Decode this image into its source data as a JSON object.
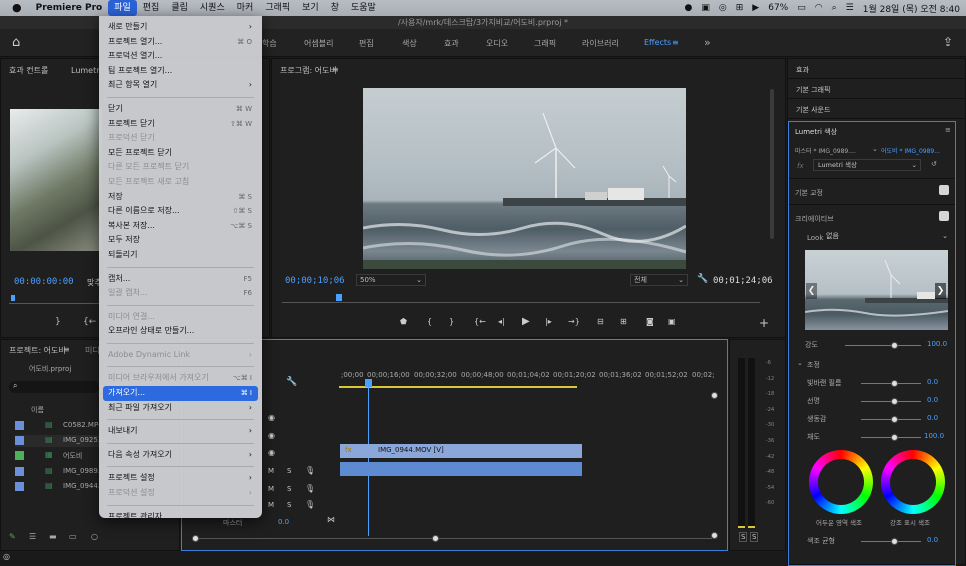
{
  "menubar": {
    "app": "Premiere Pro",
    "items": [
      "파일",
      "편집",
      "클립",
      "시퀀스",
      "마커",
      "그래픽",
      "보기",
      "창",
      "도움말"
    ],
    "battery": "67%",
    "datetime": "1월 28일 (목) 오전 8:40"
  },
  "title": "/사용자/mrk/데스크탑/3가지비교/어도비.prproj *",
  "workspaces": [
    "학습",
    "어셈블리",
    "편집",
    "색상",
    "효과",
    "오디오",
    "그래픽",
    "라이브러리",
    "Effects"
  ],
  "file_menu": {
    "groups": [
      [
        {
          "label": "새로 만들기",
          "shortcut": "",
          "arrow": true,
          "disabled": false
        },
        {
          "label": "프로젝트 열기...",
          "shortcut": "⌘ O",
          "arrow": false,
          "disabled": false
        },
        {
          "label": "프로덕션 열기...",
          "shortcut": "",
          "arrow": false,
          "disabled": false
        },
        {
          "label": "팀 프로젝트 열기...",
          "shortcut": "",
          "arrow": false,
          "disabled": false
        },
        {
          "label": "최근 항목 열기",
          "shortcut": "",
          "arrow": true,
          "disabled": false
        }
      ],
      [
        {
          "label": "닫기",
          "shortcut": "⌘ W",
          "arrow": false,
          "disabled": false
        },
        {
          "label": "프로젝트 닫기",
          "shortcut": "⇧⌘ W",
          "arrow": false,
          "disabled": false
        },
        {
          "label": "프로덕션 닫기",
          "shortcut": "",
          "arrow": false,
          "disabled": true
        },
        {
          "label": "모든 프로젝트 닫기",
          "shortcut": "",
          "arrow": false,
          "disabled": false
        },
        {
          "label": "다른 모든 프로젝트 닫기",
          "shortcut": "",
          "arrow": false,
          "disabled": true
        },
        {
          "label": "모든 프로젝트 새로 고침",
          "shortcut": "",
          "arrow": false,
          "disabled": true
        },
        {
          "label": "저장",
          "shortcut": "⌘ S",
          "arrow": false,
          "disabled": false
        },
        {
          "label": "다른 이름으로 저장...",
          "shortcut": "⇧⌘ S",
          "arrow": false,
          "disabled": false
        },
        {
          "label": "복사본 저장...",
          "shortcut": "⌥⌘ S",
          "arrow": false,
          "disabled": false
        },
        {
          "label": "모두 저장",
          "shortcut": "",
          "arrow": false,
          "disabled": false
        },
        {
          "label": "되돌리기",
          "shortcut": "",
          "arrow": false,
          "disabled": false
        }
      ],
      [
        {
          "label": "캡처...",
          "shortcut": "F5",
          "arrow": false,
          "disabled": false
        },
        {
          "label": "일괄 캡처...",
          "shortcut": "F6",
          "arrow": false,
          "disabled": true
        }
      ],
      [
        {
          "label": "미디어 연결...",
          "shortcut": "",
          "arrow": false,
          "disabled": true
        },
        {
          "label": "오프라인 상태로 만들기...",
          "shortcut": "",
          "arrow": false,
          "disabled": false
        }
      ],
      [
        {
          "label": "Adobe Dynamic Link",
          "shortcut": "",
          "arrow": true,
          "disabled": true
        }
      ],
      [
        {
          "label": "미디어 브라우저에서 가져오기",
          "shortcut": "⌥⌘ I",
          "arrow": false,
          "disabled": true
        },
        {
          "label": "가져오기...",
          "shortcut": "⌘ I",
          "arrow": false,
          "disabled": false,
          "highlight": true
        },
        {
          "label": "최근 파일 가져오기",
          "shortcut": "",
          "arrow": true,
          "disabled": false
        }
      ],
      [
        {
          "label": "내보내기",
          "shortcut": "",
          "arrow": true,
          "disabled": false
        }
      ],
      [
        {
          "label": "다음 속성 가져오기",
          "shortcut": "",
          "arrow": true,
          "disabled": false
        }
      ],
      [
        {
          "label": "프로젝트 설정",
          "shortcut": "",
          "arrow": true,
          "disabled": false
        },
        {
          "label": "프로덕션 설정",
          "shortcut": "",
          "arrow": true,
          "disabled": true
        }
      ],
      [
        {
          "label": "프로젝트 관리자...",
          "shortcut": "",
          "arrow": false,
          "disabled": false
        }
      ]
    ]
  },
  "source_panel": {
    "tabs": [
      "효과 컨트롤",
      "Lumetri 범"
    ],
    "timecode": "00:00:00:00",
    "fit": "맞추"
  },
  "program": {
    "title": "프로그램: 어도비",
    "timecode": "00;00;10;06",
    "zoom": "50%",
    "quality": "전체",
    "duration": "00;01;24;06"
  },
  "project": {
    "title": "프로젝트: 어도비",
    "tab2": "미디",
    "file": "어도비.prproj",
    "col_name": "이름",
    "items": [
      "C0582.MP4",
      "IMG_0925.M",
      "어도비",
      "IMG_0989.",
      "IMG_0944."
    ]
  },
  "timeline": {
    "ruler": [
      ";00;00",
      "00;00;16;00",
      "00;00;32;00",
      "00;00;48;00",
      "00;01;04;02",
      "00;01;20;02",
      "00;01;36;02",
      "00;01;52;02",
      "00;02;"
    ],
    "clip": "IMG_0944.MOV [V]",
    "master": "마스터",
    "master_val": "0.0",
    "track_letters": [
      "M",
      "S"
    ]
  },
  "meter_scale": [
    "-6",
    "-12",
    "-18",
    "-24",
    "-30",
    "-36",
    "-42",
    "-48",
    "-54",
    "-60"
  ],
  "meter_buttons": [
    "S",
    "S"
  ],
  "effects_panel": {
    "items": [
      "효과",
      "기본 그래픽",
      "기본 사운드"
    ],
    "lumetri_title": "Lumetri 색상",
    "master": "마스터 * IMG_0989....",
    "target": "어도비 * IMG_0989...",
    "fx": "fx",
    "fx_name": "Lumetri 색상",
    "basic": "기본 교정",
    "creative": "크리에이티브",
    "look_label": "Look",
    "look_value": "없음",
    "intensity_label": "강도",
    "intensity": "100.0",
    "adjust": "조정",
    "faded_label": "빛바랜 필름",
    "faded": "0.0",
    "sharpen_label": "선명",
    "sharpen": "0.0",
    "vibrance_label": "생동감",
    "vibrance": "0.0",
    "saturation_label": "채도",
    "saturation": "100.0",
    "wheel1": "어두운 영역 색조",
    "wheel2": "강조 표시 색조",
    "balance_label": "색조 균형",
    "balance": "0.0"
  }
}
